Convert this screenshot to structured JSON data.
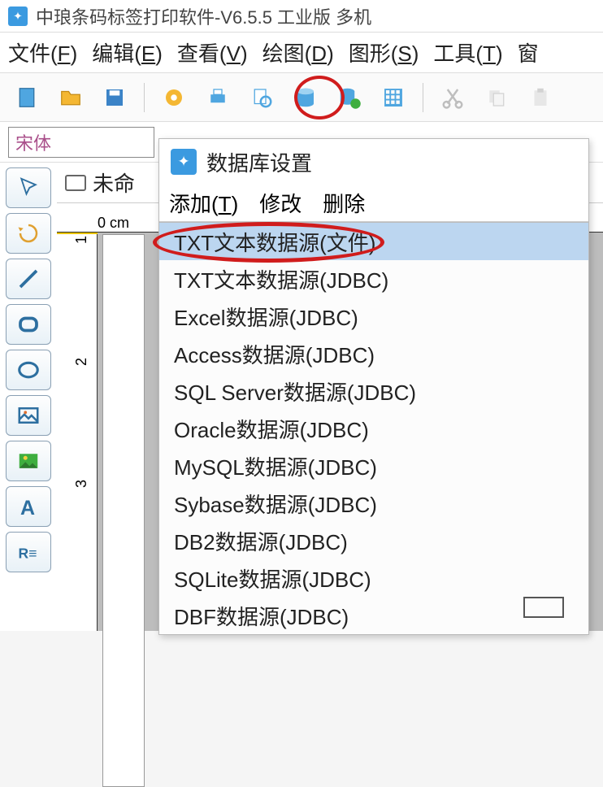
{
  "titlebar": {
    "title": "中琅条码标签打印软件-V6.5.5 工业版 多机"
  },
  "menubar": {
    "items": [
      {
        "label": "文件(F)",
        "ul": "F"
      },
      {
        "label": "编辑(E)",
        "ul": "E"
      },
      {
        "label": "查看(V)",
        "ul": "V"
      },
      {
        "label": "绘图(D)",
        "ul": "D"
      },
      {
        "label": "图形(S)",
        "ul": "S"
      },
      {
        "label": "工具(T)",
        "ul": "T"
      },
      {
        "label": "窗",
        "ul": ""
      }
    ]
  },
  "toolbar": {
    "icons": {
      "new": "new-doc-icon",
      "open": "open-folder-icon",
      "save": "save-icon",
      "gear": "gear-icon",
      "print": "print-icon",
      "preview": "preview-icon",
      "database": "database-icon",
      "db_refresh": "database-refresh-icon",
      "grid": "grid-icon",
      "cut": "cut-icon",
      "copy": "copy-icon",
      "paste": "paste-icon"
    }
  },
  "font": {
    "name": "宋体"
  },
  "tab": {
    "label": "未命"
  },
  "ruler": {
    "h0": "0 cm",
    "v": [
      "1",
      "2",
      "3"
    ]
  },
  "dialog": {
    "title": "数据库设置",
    "menu": {
      "add": "添加(T)",
      "modify": "修改",
      "delete": "删除"
    },
    "items": [
      "TXT文本数据源(文件)",
      "TXT文本数据源(JDBC)",
      "Excel数据源(JDBC)",
      "Access数据源(JDBC)",
      "SQL Server数据源(JDBC)",
      "Oracle数据源(JDBC)",
      "MySQL数据源(JDBC)",
      "Sybase数据源(JDBC)",
      "DB2数据源(JDBC)",
      "SQLite数据源(JDBC)",
      "DBF数据源(JDBC)"
    ]
  }
}
